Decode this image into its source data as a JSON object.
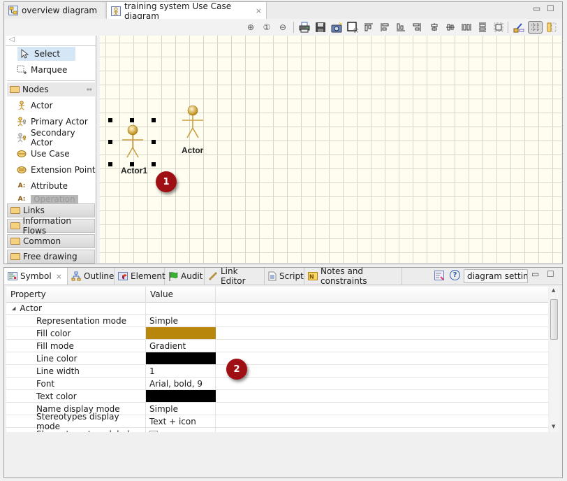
{
  "editor": {
    "tabs": [
      {
        "label": "overview diagram",
        "icon": "overview-diagram-icon",
        "active": false
      },
      {
        "label": "training system Use Case diagram",
        "icon": "usecase-diagram-icon",
        "active": true,
        "close": "⨯"
      }
    ],
    "window_buttons": {
      "minimize": "▭",
      "maximize": "☐"
    },
    "toolbar": [
      {
        "name": "zoom-in-icon",
        "glyph": "⊕"
      },
      {
        "name": "zoom-reset-icon",
        "glyph": "①"
      },
      {
        "name": "zoom-out-icon",
        "glyph": "⊖"
      },
      {
        "name": "print-icon",
        "glyph": "🖶"
      },
      {
        "name": "save-icon",
        "glyph": "💾"
      },
      {
        "name": "camera-icon",
        "glyph": "📷"
      },
      {
        "name": "fit-to-page-icon",
        "glyph": "◫"
      },
      {
        "name": "align-top-icon",
        "glyph": "⫪"
      },
      {
        "name": "align-left-icon",
        "glyph": "⊫"
      },
      {
        "name": "align-bottom-icon",
        "glyph": "⫫"
      },
      {
        "name": "align-right-icon",
        "glyph": "⊣"
      },
      {
        "name": "align-center-horizontal-icon",
        "glyph": "⌯"
      },
      {
        "name": "align-middle-icon",
        "glyph": "⊶"
      },
      {
        "name": "same-width-icon",
        "glyph": "⫴"
      },
      {
        "name": "same-height-icon",
        "glyph": "⊟"
      },
      {
        "name": "same-size-icon",
        "glyph": "⬚"
      },
      {
        "name": "format-painter-icon",
        "glyph": "🖌"
      },
      {
        "name": "show-grid-icon",
        "glyph": "▦"
      },
      {
        "name": "layout-icon",
        "glyph": "▥"
      }
    ]
  },
  "palette": {
    "collapse_glyph": "◁",
    "tools": [
      {
        "label": "Select",
        "icon": "select-arrow-icon",
        "glyph": "↖",
        "selected": true
      },
      {
        "label": "Marquee",
        "icon": "marquee-icon",
        "glyph": "⬚"
      }
    ],
    "nodes_drawer": {
      "label": "Nodes",
      "pin_glyph": "⇔"
    },
    "nodes": [
      {
        "label": "Actor",
        "icon": "actor-icon",
        "glyph": "웃"
      },
      {
        "label": "Primary Actor",
        "icon": "primary-actor-icon",
        "glyph": "웃"
      },
      {
        "label": "Secondary Actor",
        "icon": "secondary-actor-icon",
        "glyph": "웃"
      },
      {
        "label": "Use Case",
        "icon": "use-case-icon",
        "glyph": "⬭"
      },
      {
        "label": "Extension Point",
        "icon": "extension-point-icon",
        "glyph": "⬭"
      },
      {
        "label": "Attribute",
        "icon": "attribute-icon",
        "glyph": "A:"
      },
      {
        "label": "Operation",
        "icon": "operation-icon",
        "glyph": "A:"
      }
    ],
    "drawers": [
      "Links",
      "Information Flows",
      "Common",
      "Free drawing"
    ]
  },
  "canvas": {
    "elements": [
      {
        "label": "Actor1",
        "selected": true
      },
      {
        "label": "Actor",
        "selected": false
      }
    ],
    "annotations": [
      "1",
      "2"
    ]
  },
  "bottom": {
    "tabs": [
      {
        "label": "Symbol",
        "icon": "symbol-icon",
        "glyph": "▤",
        "active": true,
        "close": "⨯"
      },
      {
        "label": "Outline",
        "icon": "outline-icon",
        "glyph": "品"
      },
      {
        "label": "Element",
        "icon": "element-icon",
        "glyph": "▧"
      },
      {
        "label": "Audit",
        "icon": "audit-flag-icon",
        "glyph": "⚑"
      },
      {
        "label": "Link Editor",
        "icon": "link-editor-icon",
        "glyph": "⛓"
      },
      {
        "label": "Script",
        "icon": "script-icon",
        "glyph": "▤"
      },
      {
        "label": "Notes and constraints",
        "icon": "notes-icon",
        "glyph": "N"
      }
    ],
    "actions": {
      "edit_glyph": "▤",
      "help_glyph": "?"
    },
    "combo_value": "diagram settings",
    "window_buttons": {
      "minimize": "▭",
      "maximize": "☐"
    },
    "table": {
      "headers": [
        "Property",
        "Value"
      ],
      "group": {
        "label": "Actor",
        "expander": "◢"
      },
      "rows": [
        {
          "property": "Representation mode",
          "value": "Simple"
        },
        {
          "property": "Fill color",
          "value": "",
          "color": "#b8860b"
        },
        {
          "property": "Fill mode",
          "value": "Gradient"
        },
        {
          "property": "Line color",
          "value": "",
          "color": "#000000"
        },
        {
          "property": "Line width",
          "value": "1"
        },
        {
          "property": "Font",
          "value": "Arial, bold, 9"
        },
        {
          "property": "Text color",
          "value": "",
          "color": "#000000"
        },
        {
          "property": "Name display mode",
          "value": "Simple"
        },
        {
          "property": "Stereotypes display mode",
          "value": "Text + icon"
        },
        {
          "property": "Show stereotype label",
          "value": "",
          "checkbox": false
        }
      ]
    }
  },
  "colors": {
    "canvas_bg": "#fffdf0",
    "grid": "#d8d6c8",
    "actor_fill": "#b8860b",
    "badge": "#9e1014",
    "selection": "#d5e6f7"
  }
}
